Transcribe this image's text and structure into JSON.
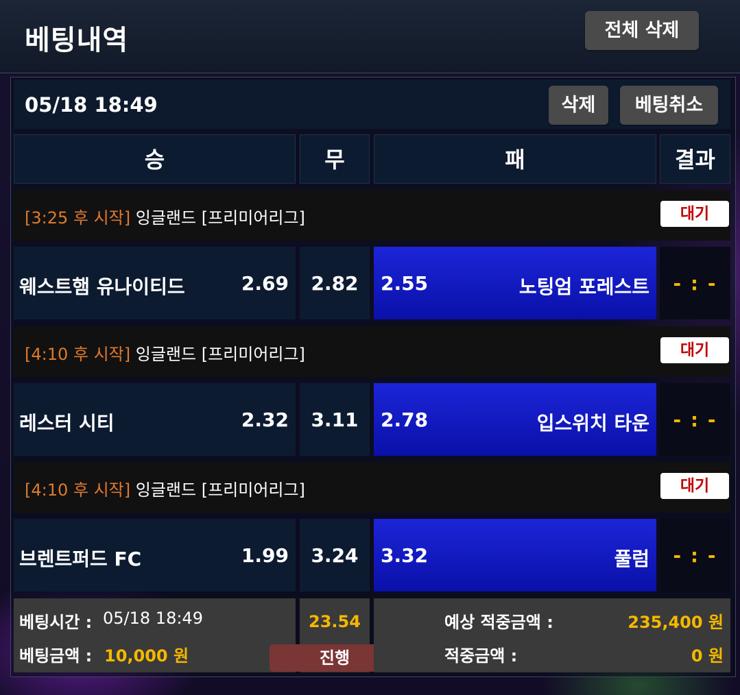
{
  "header": {
    "title": "베팅내역",
    "delete_all_label": "전체 삭제"
  },
  "bet": {
    "date": "05/18 18:49",
    "delete_label": "삭제",
    "cancel_label": "베팅취소",
    "columns": {
      "win": "승",
      "draw": "무",
      "lose": "패",
      "result": "결과"
    },
    "matches": [
      {
        "start_time": "[3:25 후 시작]",
        "league": "잉글랜드 [프리미어리그]",
        "status": "대기",
        "home": "웨스트햄 유나이티드",
        "home_odds": "2.69",
        "draw_odds": "2.82",
        "away_odds": "2.55",
        "away": "노팅엄 포레스트",
        "result": "- : -"
      },
      {
        "start_time": "[4:10 후 시작]",
        "league": "잉글랜드 [프리미어리그]",
        "status": "대기",
        "home": "레스터 시티",
        "home_odds": "2.32",
        "draw_odds": "3.11",
        "away_odds": "2.78",
        "away": "입스위치 타운",
        "result": "- : -"
      },
      {
        "start_time": "[4:10 후 시작]",
        "league": "잉글랜드 [프리미어리그]",
        "status": "대기",
        "home": "브렌트퍼드 FC",
        "home_odds": "1.99",
        "draw_odds": "3.24",
        "away_odds": "3.32",
        "away": "풀럼",
        "result": "- : -"
      }
    ],
    "summary": {
      "bet_time_label": "베팅시간 :",
      "bet_time": "05/18 18:49",
      "bet_amount_label": "베팅금액 :",
      "bet_amount": "10,000 원",
      "total_odds": "23.54",
      "progress_label": "진행",
      "expected_label": "예상 적중금액 :",
      "expected_amount": "235,400 원",
      "won_label": "적중금액 :",
      "won_amount": "0 원"
    }
  }
}
